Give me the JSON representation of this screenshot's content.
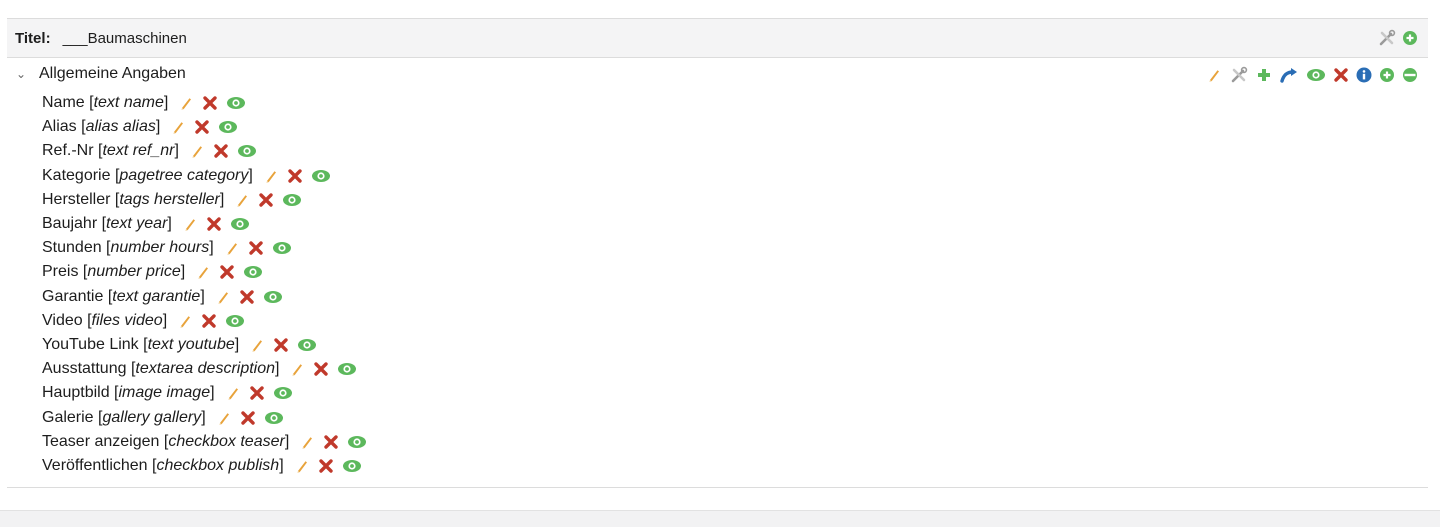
{
  "header": {
    "title_label": "Titel:",
    "title_value": "___Baumaschinen"
  },
  "group": {
    "label": "Allgemeine Angaben"
  },
  "fields": [
    {
      "label": "Name",
      "type": "text name"
    },
    {
      "label": "Alias",
      "type": "alias alias"
    },
    {
      "label": "Ref.-Nr",
      "type": "text ref_nr"
    },
    {
      "label": "Kategorie",
      "type": "pagetree category"
    },
    {
      "label": "Hersteller",
      "type": "tags hersteller"
    },
    {
      "label": "Baujahr",
      "type": "text year"
    },
    {
      "label": "Stunden",
      "type": "number hours"
    },
    {
      "label": "Preis",
      "type": "number price"
    },
    {
      "label": "Garantie",
      "type": "text garantie"
    },
    {
      "label": "Video",
      "type": "files video"
    },
    {
      "label": "YouTube Link",
      "type": "text youtube"
    },
    {
      "label": "Ausstattung",
      "type": "textarea description"
    },
    {
      "label": "Hauptbild",
      "type": "image image"
    },
    {
      "label": "Galerie",
      "type": "gallery gallery"
    },
    {
      "label": "Teaser anzeigen",
      "type": "checkbox teaser"
    },
    {
      "label": "Veröffentlichen",
      "type": "checkbox publish"
    }
  ],
  "field_actions": [
    "pencil-icon",
    "delete-icon",
    "eye-icon"
  ],
  "title_actions": [
    "tools-icon",
    "add-circle-icon"
  ],
  "group_actions": [
    "pencil-icon",
    "tools-icon",
    "plus-icon",
    "move-arrow-icon",
    "eye-icon",
    "delete-icon",
    "info-icon",
    "add-circle-icon",
    "minus-circle-icon"
  ],
  "colors": {
    "pencil": "#e8a33b",
    "delete": "#c0392b",
    "green": "#5cb85c",
    "blue": "#2a6db5",
    "tools": "#9a9a9a"
  }
}
